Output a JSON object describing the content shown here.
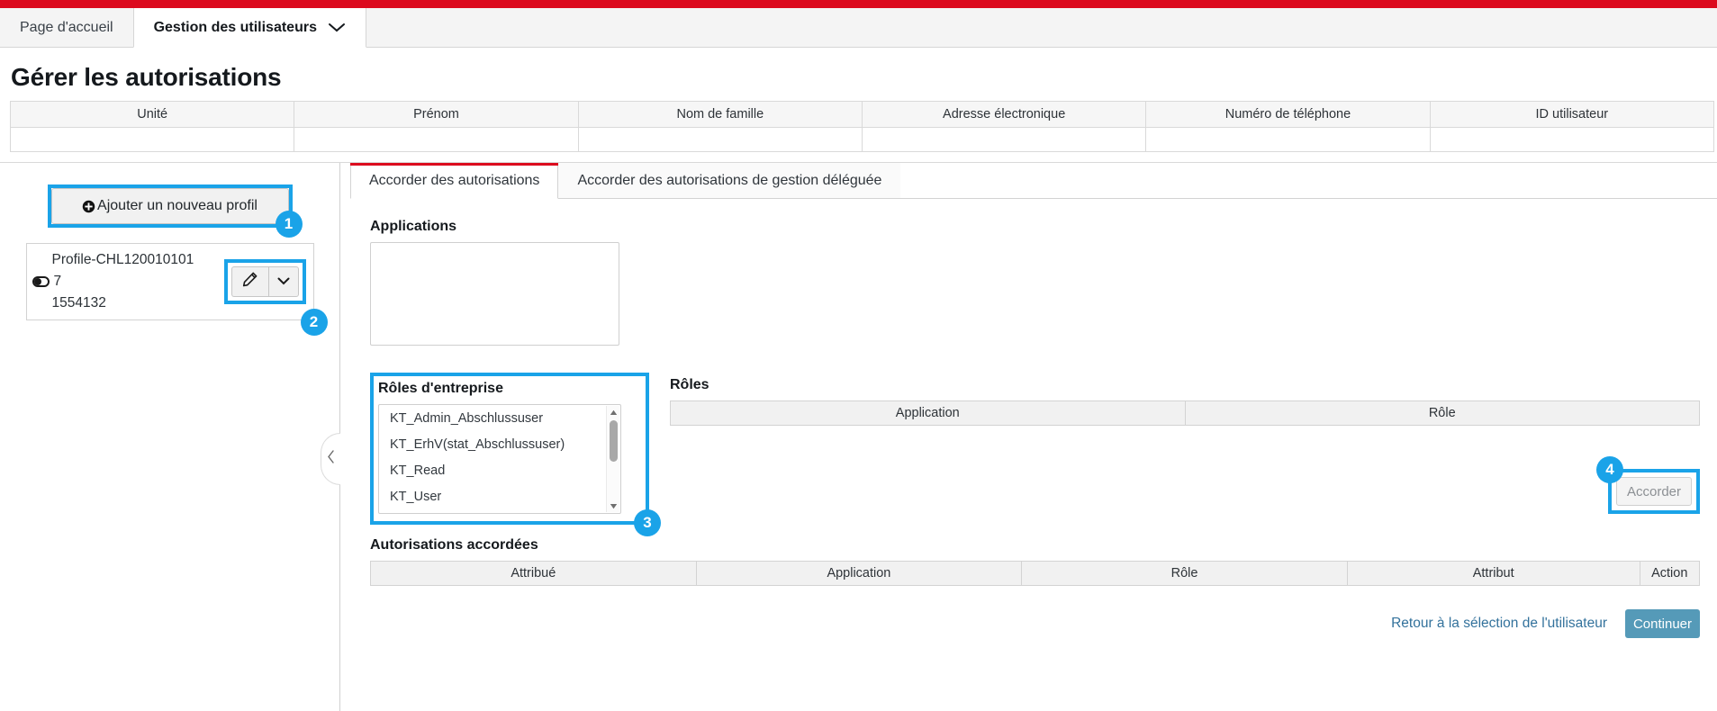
{
  "theme": {
    "accent_red": "#dc0a1e",
    "highlight_blue": "#1aa3e8",
    "primary_button": "#559ab8",
    "link_color": "#33729c"
  },
  "nav": {
    "items": [
      {
        "label": "Page d'accueil",
        "active": false
      },
      {
        "label": "Gestion des utilisateurs",
        "active": true,
        "icon": "chevron-down-icon"
      }
    ]
  },
  "page": {
    "title": "Gérer les autorisations"
  },
  "user_table": {
    "headers": [
      "Unité",
      "Prénom",
      "Nom de famille",
      "Adresse électronique",
      "Numéro de téléphone",
      "ID utilisateur"
    ],
    "rows": [
      [
        "",
        "",
        "",
        "",
        "",
        ""
      ]
    ]
  },
  "left_panel": {
    "add_profile_label": "Ajouter un nouveau profil",
    "add_profile_icon": "plus-circle-icon",
    "badge_add_profile": "1",
    "badge_edit_group": "2",
    "profile": {
      "name": "Profile-CHL120010101",
      "toggle_value": "7",
      "id": "1554132",
      "edit_icon": "pencil-icon",
      "caret_icon": "chevron-down-icon"
    },
    "collapse_icon": "chevron-left-icon"
  },
  "tabs": [
    {
      "label": "Accorder des autorisations",
      "active": true
    },
    {
      "label": "Accorder des autorisations de gestion déléguée",
      "active": false
    }
  ],
  "main": {
    "applications_label": "Applications",
    "applications_items": [],
    "enterprise_roles_label": "Rôles d'entreprise",
    "enterprise_roles_items": [
      "KT_Admin_Abschlussuser",
      "KT_ErhV(stat_Abschlussuser)",
      "KT_Read",
      "KT_User"
    ],
    "badge_enterprise_roles": "3",
    "roles_label": "Rôles",
    "roles_headers": [
      "Application",
      "Rôle"
    ],
    "roles_rows": [],
    "grant_button_label": "Accorder",
    "badge_grant": "4",
    "granted_label": "Autorisations accordées",
    "granted_headers": [
      "Attribué",
      "Application",
      "Rôle",
      "Attribut",
      "Action"
    ],
    "granted_rows": []
  },
  "footer": {
    "back_link": "Retour à la sélection de l'utilisateur",
    "continue_label": "Continuer"
  }
}
